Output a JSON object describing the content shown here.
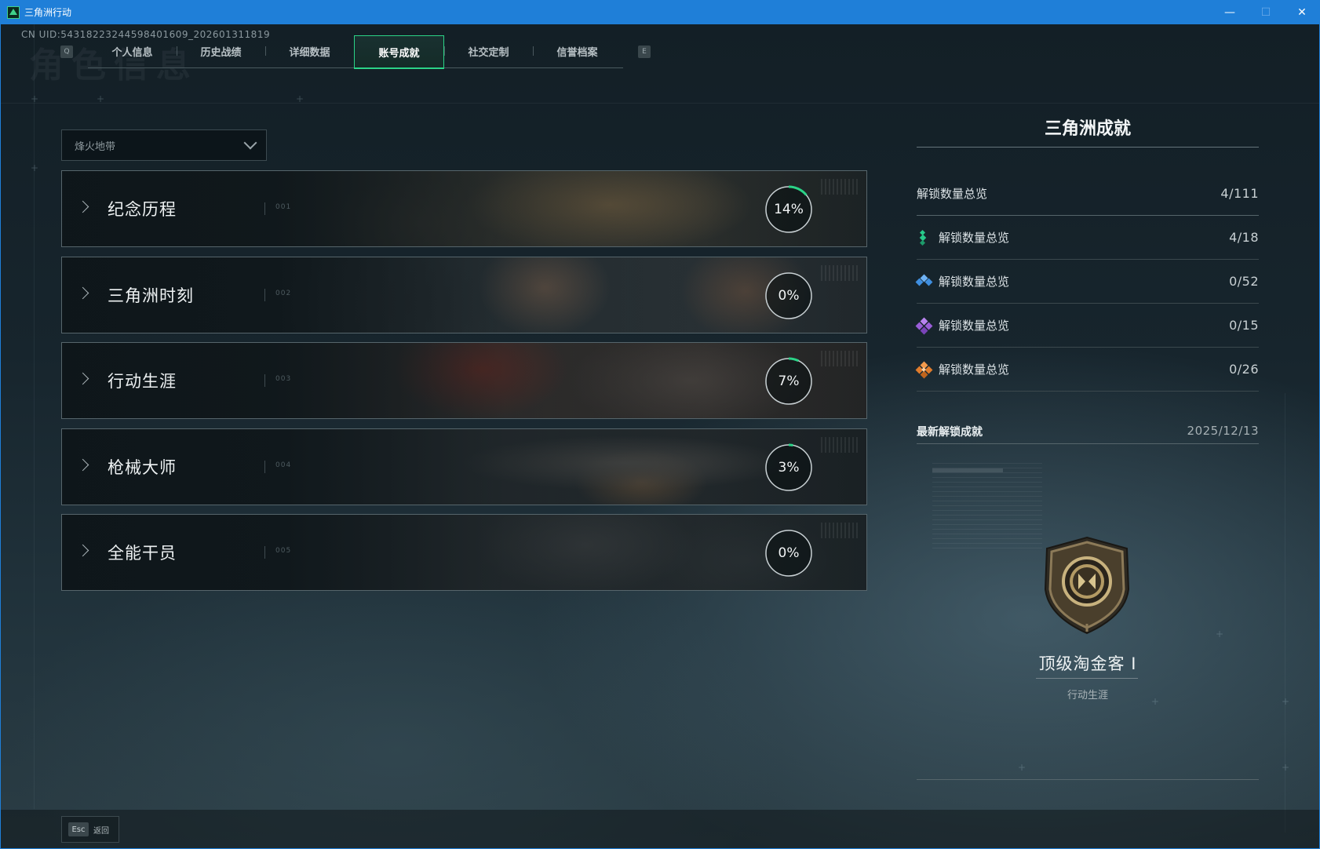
{
  "window": {
    "title": "三角洲行动",
    "controls": {
      "minimize": "—",
      "maximize": "☐",
      "close": "✕"
    }
  },
  "uid": "CN UID:5431822324459840160​9_202601311819",
  "background_watermark": "角色信息",
  "tabs": {
    "left_key": "Q",
    "right_key": "E",
    "items": [
      {
        "label": "个人信息",
        "active": false
      },
      {
        "label": "历史战绩",
        "active": false
      },
      {
        "label": "详细数据",
        "active": false
      },
      {
        "label": "账号成就",
        "active": true
      },
      {
        "label": "社交定制",
        "active": false
      },
      {
        "label": "信誉档案",
        "active": false
      }
    ]
  },
  "mode_dropdown": {
    "value": "烽火地带"
  },
  "categories": [
    {
      "name": "纪念历程",
      "num": "001",
      "percent": 14,
      "percent_label": "14%"
    },
    {
      "name": "三角洲时刻",
      "num": "002",
      "percent": 0,
      "percent_label": "0%"
    },
    {
      "name": "行动生涯",
      "num": "003",
      "percent": 7,
      "percent_label": "7%"
    },
    {
      "name": "枪械大师",
      "num": "004",
      "percent": 3,
      "percent_label": "3%"
    },
    {
      "name": "全能干员",
      "num": "005",
      "percent": 0,
      "percent_label": "0%"
    }
  ],
  "panel": {
    "title": "三角洲成就",
    "total": {
      "label": "解锁数量总览",
      "value": "4/111"
    },
    "tiers": [
      {
        "label": "解锁数量总览",
        "value": "4/18",
        "icon": "green-gem-icon",
        "color": "#27c98a"
      },
      {
        "label": "解锁数量总览",
        "value": "0/52",
        "icon": "blue-gem-icon",
        "color": "#3f8fe0"
      },
      {
        "label": "解锁数量总览",
        "value": "0/15",
        "icon": "purple-gem-icon",
        "color": "#9a5ed8"
      },
      {
        "label": "解锁数量总览",
        "value": "0/26",
        "icon": "orange-gem-icon",
        "color": "#e07c2c"
      }
    ],
    "latest": {
      "label": "最新解锁成就",
      "date": "2025/12/13",
      "achievement_name": "顶级淘金客 I",
      "achievement_category": "行动生涯",
      "badge_icon": "gold-shield-badge-icon"
    }
  },
  "footer": {
    "esc_key": "Esc",
    "back_label": "返回"
  },
  "colors": {
    "accent": "#2bd387",
    "titlebar": "#1f7fd8"
  }
}
